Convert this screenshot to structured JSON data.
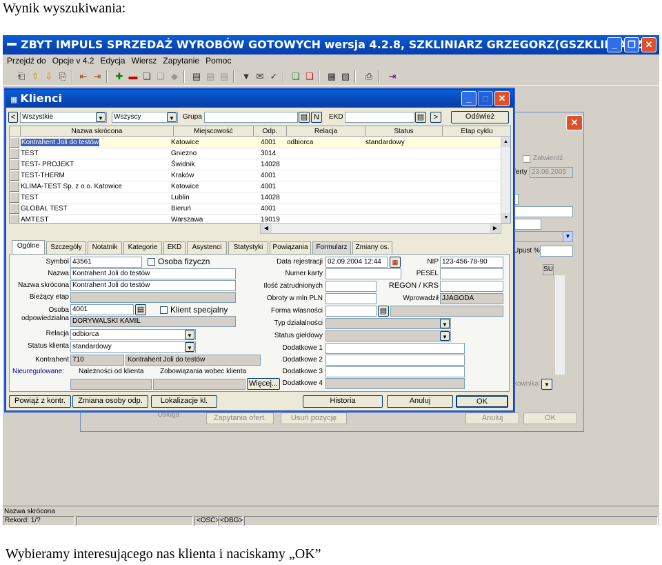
{
  "caption_top": "Wynik wyszukiwania:",
  "caption_bottom": "Wybieramy interesującego nas klienta i naciskamy „OK”",
  "app": {
    "title": "ZBYT IMPULS SPRZEDAŻ WYROBÓW GOTOWYCH wersja 4.2.8, SZKLINIARZ GRZEGORZ(GSZKLINIARZ...",
    "menu": [
      "Przejdź do",
      "Opcje v 4.2",
      "Edycja",
      "Wiersz",
      "Zapytanie",
      "Pomoc"
    ]
  },
  "back_window": {
    "zatwierdz": "Zatwierdź",
    "oferty_label": "ferty",
    "oferty_date": "23.06.2005",
    "upust_label": "Upust %",
    "su": "SU",
    "usluga": "Usługa",
    "kownika": "kownika",
    "btn_zapytania": "Zapytania ofert.",
    "btn_usun": "Usuń pozycję",
    "btn_anuluj": "Anuluj",
    "btn_ok": "OK"
  },
  "clients": {
    "title": "Klienci",
    "filter1": "Wszystkie",
    "filter2": "Wszyscy",
    "grupa_label": "Grupa",
    "n_btn": "N",
    "ekd_label": "EKD",
    "refresh": "Odśwież",
    "nav_left": "<",
    "nav_right": ">",
    "columns": [
      "Nazwa skrócona",
      "Miejscowość",
      "Odp.",
      "Relacja",
      "Status",
      "Etap cyklu"
    ],
    "rows": [
      {
        "name": "Kontrahent Joli do testów",
        "city": "Katowice",
        "odp": "4001",
        "rel": "odbiorca",
        "status": "standardowy"
      },
      {
        "name": "TEST",
        "city": "Gniezno",
        "odp": "3014",
        "rel": "",
        "status": ""
      },
      {
        "name": "TEST- PROJEKT",
        "city": "Świdnik",
        "odp": "14028",
        "rel": "",
        "status": ""
      },
      {
        "name": "TEST-THERM",
        "city": "Kraków",
        "odp": "4001",
        "rel": "",
        "status": ""
      },
      {
        "name": "KLIMA-TEST Sp. z o.o. Katowice",
        "city": "Katowice",
        "odp": "4001",
        "rel": "",
        "status": ""
      },
      {
        "name": "TEST",
        "city": "Lublin",
        "odp": "14028",
        "rel": "",
        "status": ""
      },
      {
        "name": "GLOBAL TEST",
        "city": "Bieruń",
        "odp": "4001",
        "rel": "",
        "status": ""
      },
      {
        "name": "AMTEST",
        "city": "Warszawa",
        "odp": "19019",
        "rel": "",
        "status": ""
      }
    ],
    "tabs": [
      "Ogólne",
      "Szczegóły",
      "Notatnik",
      "Kategorie",
      "EKD",
      "Asystenci",
      "Statystyki",
      "Powiązania",
      "Formularz",
      "Zmiany os."
    ],
    "form": {
      "symbol_label": "Symbol",
      "symbol": "43561",
      "osoba_fizyczna": "Osoba fizyczn",
      "nazwa_label": "Nazwa",
      "nazwa": "Kontrahent Joli do testów",
      "nazwa_skr_label": "Nazwa skrócona",
      "nazwa_skr": "Kontrahent Joli do testów",
      "etap_label": "Bieżący etap",
      "osoba_label": "Osoba",
      "odp_label": "odpowiedzialna",
      "osoba_id": "4001",
      "osoba_name": "DORYWALSKI KAMIL",
      "klient_spec": "Klient specjalny",
      "relacja_label": "Relacja",
      "relacja": "odbiorca",
      "status_label": "Status klienta",
      "status": "standardowy",
      "kontrahent_label": "Kontrahent",
      "kontrahent_id": "710",
      "kontrahent_name": "Kontrahent Joli do testów",
      "nieuregulowane": "Nieuregulowane:",
      "naleznosci": "Należności od klienta",
      "zobowiazania": "Zobowiązania wobec klienta",
      "wiecej": "Więcej...",
      "data_rej_label": "Data rejestracji",
      "data_rej": "02.09.2004 12:44",
      "nip_label": "NIP",
      "nip": "123-456-78-90",
      "numer_karty_label": "Numer karty",
      "pesel_label": "PESEL",
      "ilosc_label": "Ilość zatrudnionych",
      "regon_label": "REGON / KRS",
      "obroty_label": "Obroty w mln PLN",
      "wprowadzil_label": "Wprowadził",
      "wprowadzil": "JJAGODA",
      "forma_label": "Forma własności",
      "typ_label": "Typ działalności",
      "gieldowy_label": "Status giełdowy",
      "dod1": "Dodatkowe 1",
      "dod2": "Dodatkowe 2",
      "dod3": "Dodatkowe 3",
      "dod4": "Dodatkowe 4"
    },
    "buttons": {
      "powiaz": "Powiąż z kontr.",
      "zmiana": "Zmiana osoby odp.",
      "lokalizacje": "Lokalizacje kl.",
      "historia": "Historia",
      "anuluj": "Anuluj",
      "ok": "OK"
    }
  },
  "statusbar": {
    "field": "Nazwa skrócona",
    "record": "Rekord: 1/?",
    "osc": "<OSC>",
    "dbg": "<DBG>"
  }
}
